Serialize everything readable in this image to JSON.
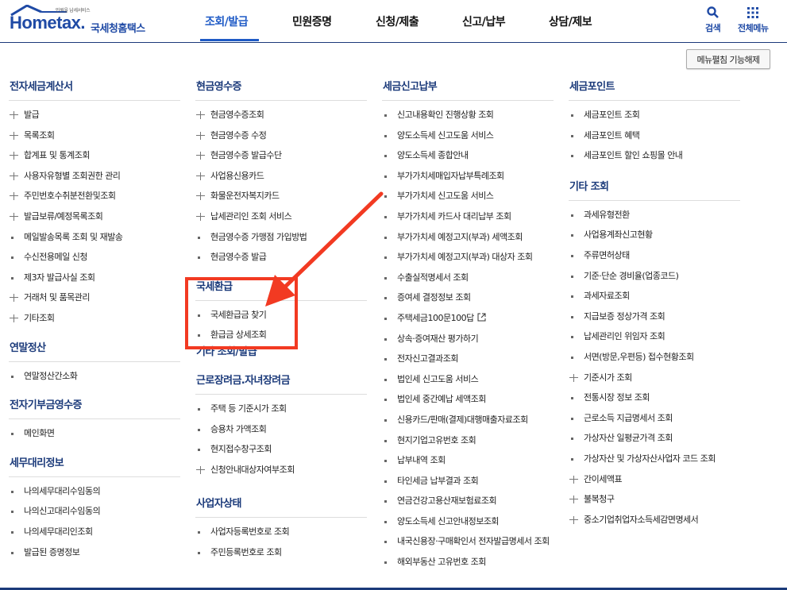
{
  "header": {
    "logo_small": "민원을 납세서비스",
    "logo_text": "Hometax.",
    "logo_kor": "국세청홈택스",
    "nav": [
      "조회/발급",
      "민원증명",
      "신청/제출",
      "신고/납부",
      "상담/제보"
    ],
    "search_label": "검색",
    "allmenu_label": "전체메뉴"
  },
  "collapse_button": "메뉴펼침 기능해제",
  "columns": [
    {
      "sections": [
        {
          "title": "전자세금계산서",
          "items": [
            {
              "label": "발급",
              "type": "plus"
            },
            {
              "label": "목록조회",
              "type": "plus"
            },
            {
              "label": "합계표 및 통계조회",
              "type": "plus"
            },
            {
              "label": "사용자유형별 조회권한 관리",
              "type": "plus"
            },
            {
              "label": "주민번호수취분전환및조회",
              "type": "plus"
            },
            {
              "label": "발급보류/예정목록조회",
              "type": "plus"
            },
            {
              "label": "메일발송목록 조회 및 재발송",
              "type": "bullet"
            },
            {
              "label": "수신전용메일 신청",
              "type": "bullet"
            },
            {
              "label": "제3자 발급사실 조회",
              "type": "bullet"
            },
            {
              "label": "거래처 및 품목관리",
              "type": "plus"
            },
            {
              "label": "기타조회",
              "type": "plus"
            }
          ]
        },
        {
          "title": "연말정산",
          "items": [
            {
              "label": "연말정산간소화",
              "type": "bullet"
            }
          ]
        },
        {
          "title": "전자기부금영수증",
          "items": [
            {
              "label": "메인화면",
              "type": "bullet"
            }
          ]
        },
        {
          "title": "세무대리정보",
          "items": [
            {
              "label": "나의세무대리수임동의",
              "type": "bullet"
            },
            {
              "label": "나의신고대리수임동의",
              "type": "bullet"
            },
            {
              "label": "나의세무대리인조회",
              "type": "bullet"
            },
            {
              "label": "발급된 증명정보",
              "type": "bullet"
            }
          ]
        }
      ]
    },
    {
      "sections": [
        {
          "title": "현금영수증",
          "items": [
            {
              "label": "현금영수증조회",
              "type": "plus"
            },
            {
              "label": "현금영수증 수정",
              "type": "plus"
            },
            {
              "label": "현금영수증 발급수단",
              "type": "plus"
            },
            {
              "label": "사업용신용카드",
              "type": "plus"
            },
            {
              "label": "화물운전자복지카드",
              "type": "plus"
            },
            {
              "label": "납세관리인 조회 서비스",
              "type": "plus"
            },
            {
              "label": "현금영수증 가맹점 가입방법",
              "type": "bullet"
            },
            {
              "label": "현금영수증 발급",
              "type": "bullet"
            }
          ]
        },
        {
          "title": "국세환급",
          "items": [
            {
              "label": "국세환급금 찾기",
              "type": "bullet"
            },
            {
              "label": "환급금 상세조회",
              "type": "bullet"
            }
          ]
        },
        {
          "title": "근로장려금.자녀장려금",
          "items": [
            {
              "label": "주택 등 기준시가 조회",
              "type": "bullet"
            },
            {
              "label": "승용차 가액조회",
              "type": "bullet"
            },
            {
              "label": "현지접수창구조회",
              "type": "bullet"
            },
            {
              "label": "신청안내대상자여부조회",
              "type": "plus"
            }
          ]
        },
        {
          "title": "사업자상태",
          "items": [
            {
              "label": "사업자등록번호로 조회",
              "type": "bullet"
            },
            {
              "label": "주민등록번호로 조회",
              "type": "bullet"
            }
          ]
        }
      ],
      "overlap_text": "기타 조회/발급"
    },
    {
      "sections": [
        {
          "title": "세금신고납부",
          "items": [
            {
              "label": "신고내용확인 진행상황 조회",
              "type": "bullet"
            },
            {
              "label": "양도소득세 신고도움 서비스",
              "type": "bullet"
            },
            {
              "label": "양도소득세 종합안내",
              "type": "bullet"
            },
            {
              "label": "부가가치세매입자납부특례조회",
              "type": "bullet"
            },
            {
              "label": "부가가치세 신고도움 서비스",
              "type": "bullet"
            },
            {
              "label": "부가가치세 카드사 대리납부 조회",
              "type": "bullet"
            },
            {
              "label": "부가가치세 예정고지(부과) 세액조회",
              "type": "bullet"
            },
            {
              "label": "부가가치세 예정고지(부과) 대상자 조회",
              "type": "bullet"
            },
            {
              "label": "수출실적명세서 조회",
              "type": "bullet"
            },
            {
              "label": "증여세 결정정보 조회",
              "type": "bullet"
            },
            {
              "label": "주택세금100문100답",
              "type": "bullet",
              "external": true
            },
            {
              "label": "상속·증여재산 평가하기",
              "type": "bullet"
            },
            {
              "label": "전자신고결과조회",
              "type": "bullet"
            },
            {
              "label": "법인세 신고도움 서비스",
              "type": "bullet"
            },
            {
              "label": "법인세 중간예납 세액조회",
              "type": "bullet"
            },
            {
              "label": "신용카드/판매(결제)대행매출자료조회",
              "type": "bullet"
            },
            {
              "label": "현지기업고유번호 조회",
              "type": "bullet"
            },
            {
              "label": "납부내역 조회",
              "type": "bullet"
            },
            {
              "label": "타인세금 납부결과 조회",
              "type": "bullet"
            },
            {
              "label": "연금건강고용산재보험료조회",
              "type": "bullet"
            },
            {
              "label": "양도소득세 신고안내정보조회",
              "type": "bullet"
            },
            {
              "label": "내국신용장·구매확인서 전자발급명세서 조회",
              "type": "bullet"
            },
            {
              "label": "해외부동산 고유번호 조회",
              "type": "bullet"
            }
          ]
        }
      ]
    },
    {
      "sections": [
        {
          "title": "세금포인트",
          "items": [
            {
              "label": "세금포인트 조회",
              "type": "bullet"
            },
            {
              "label": "세금포인트 혜택",
              "type": "bullet"
            },
            {
              "label": "세금포인트 할인 쇼핑몰 안내",
              "type": "bullet"
            }
          ]
        },
        {
          "title": "기타 조회",
          "items": [
            {
              "label": "과세유형전환",
              "type": "bullet"
            },
            {
              "label": "사업용계좌신고현황",
              "type": "bullet"
            },
            {
              "label": "주류면허상태",
              "type": "bullet"
            },
            {
              "label": "기준·단순 경비율(업종코드)",
              "type": "bullet"
            },
            {
              "label": "과세자료조회",
              "type": "bullet"
            },
            {
              "label": "지급보증 정상가격 조회",
              "type": "bullet"
            },
            {
              "label": "납세관리인 위임자 조회",
              "type": "bullet"
            },
            {
              "label": "서면(방문,우편등) 접수현황조회",
              "type": "bullet"
            },
            {
              "label": "기준시가 조회",
              "type": "plus"
            },
            {
              "label": "전통시장 정보 조회",
              "type": "bullet"
            },
            {
              "label": "근로소득 지급명세서 조회",
              "type": "bullet"
            },
            {
              "label": "가상자산 일평균가격 조회",
              "type": "bullet"
            },
            {
              "label": "가상자산 및 가상자산사업자 코드 조회",
              "type": "bullet"
            },
            {
              "label": "간이세액표",
              "type": "plus"
            },
            {
              "label": "불복청구",
              "type": "plus"
            },
            {
              "label": "중소기업취업자소득세감면명세서",
              "type": "plus"
            }
          ]
        }
      ]
    }
  ],
  "colors": {
    "brand": "#1f4aa5",
    "nav_active": "#1f5bc6",
    "section_title": "#1b3a7a",
    "annotation": "#f23a22"
  }
}
